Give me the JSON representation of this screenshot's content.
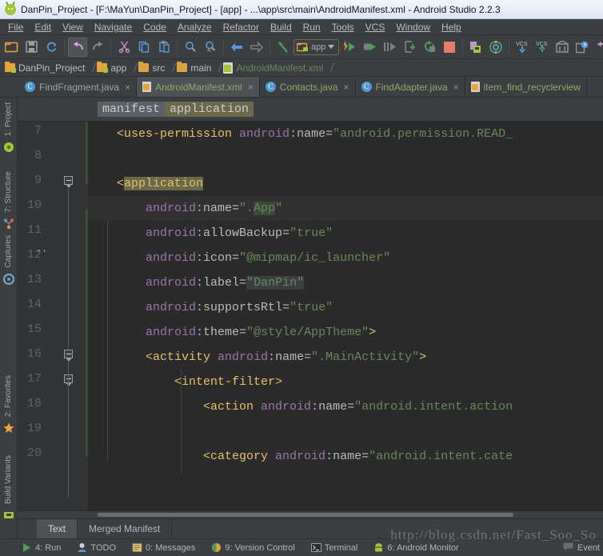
{
  "window": {
    "title": "DanPin_Project - [F:\\MaYun\\DanPin_Project] - [app] - ...\\app\\src\\main\\AndroidManifest.xml - Android Studio 2.2.3",
    "app_icon": "android-icon"
  },
  "menubar": [
    {
      "label": "File"
    },
    {
      "label": "Edit"
    },
    {
      "label": "View"
    },
    {
      "label": "Navigate"
    },
    {
      "label": "Code"
    },
    {
      "label": "Analyze"
    },
    {
      "label": "Refactor"
    },
    {
      "label": "Build"
    },
    {
      "label": "Run"
    },
    {
      "label": "Tools"
    },
    {
      "label": "VCS"
    },
    {
      "label": "Window"
    },
    {
      "label": "Help"
    }
  ],
  "toolbar": {
    "run_config_label": "app",
    "icons": [
      "open-folder-icon",
      "save-all-icon",
      "sync-icon",
      "undo-icon",
      "redo-icon",
      "cut-icon",
      "copy-icon",
      "paste-icon",
      "find-icon",
      "replace-icon",
      "back-icon",
      "forward-icon",
      "jump-to-source-icon",
      "run-icon",
      "debug-icon",
      "attach-debugger-icon",
      "stop-at-icon",
      "rerun-icon",
      "stop-icon",
      "avd-manager-icon",
      "sdk-manager-icon",
      "vcs-update-icon",
      "vcs-commit-icon",
      "sync-gradle-icon",
      "layout-inspector-icon",
      "revert-icon"
    ]
  },
  "navbar": {
    "crumbs": [
      {
        "label": "DanPin_Project",
        "icon": "project-folder-icon"
      },
      {
        "label": "app",
        "icon": "module-folder-icon"
      },
      {
        "label": "src",
        "icon": "folder-icon"
      },
      {
        "label": "main",
        "icon": "folder-icon"
      },
      {
        "label": "AndroidManifest.xml",
        "icon": "xml-file-icon"
      }
    ]
  },
  "editor_tabs": [
    {
      "label": "FindFragment.java",
      "icon": "java-class-icon",
      "active": false,
      "close": "×"
    },
    {
      "label": "AndroidManifest.xml",
      "icon": "manifest-file-icon",
      "active": true,
      "close": "×"
    },
    {
      "label": "Contacts.java",
      "icon": "java-class-icon",
      "active": false,
      "close": "×"
    },
    {
      "label": "FindAdapter.java",
      "icon": "java-class-icon",
      "active": false,
      "close": "×"
    },
    {
      "label": "item_find_recyclerview",
      "icon": "xml-file-icon",
      "active": false,
      "close": ""
    }
  ],
  "structure_bar": {
    "chips": [
      {
        "label": "manifest",
        "state": "selected"
      },
      {
        "label": "application",
        "state": "highlight"
      }
    ]
  },
  "left_strip": [
    {
      "label": "1: Project",
      "accel": "1"
    },
    {
      "label": "7: Structure",
      "accel": "7"
    },
    {
      "label": "Captures",
      "accel": ""
    },
    {
      "label": "2: Favorites",
      "accel": "2"
    },
    {
      "label": "Build Variants",
      "accel": ""
    }
  ],
  "editor": {
    "first_line": 7,
    "caret_line": 10,
    "lines": [
      {
        "num": 7,
        "indent": 4,
        "text": "<uses-permission android:name=\"android.permission.READ_"
      },
      {
        "num": 8,
        "indent": 0,
        "text": ""
      },
      {
        "num": 9,
        "indent": 4,
        "text": "<application"
      },
      {
        "num": 10,
        "indent": 8,
        "text": "android:name=\".App\""
      },
      {
        "num": 11,
        "indent": 8,
        "text": "android:allowBackup=\"true\""
      },
      {
        "num": 12,
        "indent": 8,
        "text": "android:icon=\"@mipmap/ic_launcher\""
      },
      {
        "num": 13,
        "indent": 8,
        "text": "android:label=\"DanPin\""
      },
      {
        "num": 14,
        "indent": 8,
        "text": "android:supportsRtl=\"true\""
      },
      {
        "num": 15,
        "indent": 8,
        "text": "android:theme=\"@style/AppTheme\">"
      },
      {
        "num": 16,
        "indent": 8,
        "text": "<activity android:name=\".MainActivity\">"
      },
      {
        "num": 17,
        "indent": 12,
        "text": "<intent-filter>"
      },
      {
        "num": 18,
        "indent": 16,
        "text": "<action android:name=\"android.intent.action"
      },
      {
        "num": 19,
        "indent": 0,
        "text": ""
      },
      {
        "num": 20,
        "indent": 16,
        "text": "<category android:name=\"android.intent.cate"
      }
    ]
  },
  "bottom_tabs": [
    {
      "label": "Text",
      "active": true
    },
    {
      "label": "Merged Manifest",
      "active": false
    }
  ],
  "statusbar": {
    "items": [
      {
        "label": "4: Run",
        "accel": "4",
        "icon": "run-icon"
      },
      {
        "label": "TODO",
        "accel": "",
        "icon": "todo-icon"
      },
      {
        "label": "0: Messages",
        "accel": "0",
        "icon": "messages-icon"
      },
      {
        "label": "9: Version Control",
        "accel": "9",
        "icon": "vcs-icon"
      },
      {
        "label": "Terminal",
        "accel": "",
        "icon": "terminal-icon"
      },
      {
        "label": "6: Android Monitor",
        "accel": "6",
        "icon": "android-icon"
      }
    ],
    "event_log": "Event",
    "watermark": "http://blog.csdn.net/Fast_Soo_So"
  },
  "colors": {
    "background": "#3c3f41",
    "editor_background": "#2b2b2b",
    "gutter": "#313335",
    "accent_orange": "#e8bf6a",
    "accent_green": "#6a8759",
    "accent_purple": "#9876aa",
    "android_green": "#a4c639",
    "highlight_olive": "#6c684a",
    "titlebar": "#e7eef7"
  }
}
